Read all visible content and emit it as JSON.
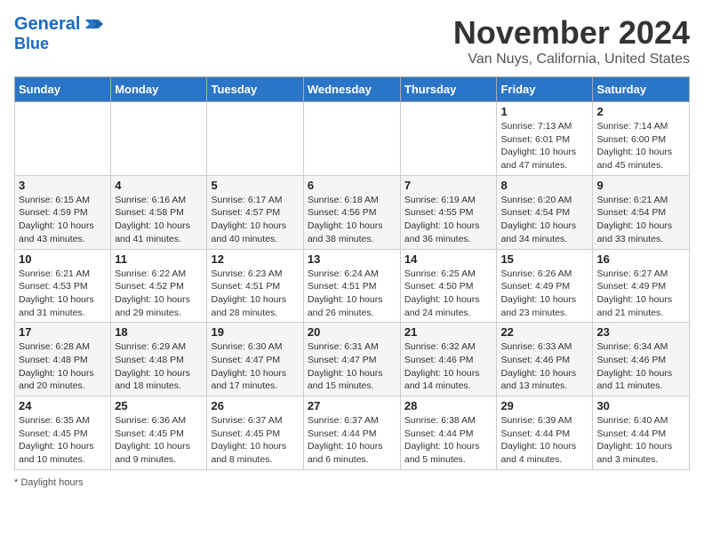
{
  "header": {
    "logo_line1": "General",
    "logo_line2": "Blue",
    "month_title": "November 2024",
    "location": "Van Nuys, California, United States"
  },
  "days_of_week": [
    "Sunday",
    "Monday",
    "Tuesday",
    "Wednesday",
    "Thursday",
    "Friday",
    "Saturday"
  ],
  "weeks": [
    [
      {
        "day": "",
        "info": ""
      },
      {
        "day": "",
        "info": ""
      },
      {
        "day": "",
        "info": ""
      },
      {
        "day": "",
        "info": ""
      },
      {
        "day": "",
        "info": ""
      },
      {
        "day": "1",
        "info": "Sunrise: 7:13 AM\nSunset: 6:01 PM\nDaylight: 10 hours and 47 minutes."
      },
      {
        "day": "2",
        "info": "Sunrise: 7:14 AM\nSunset: 6:00 PM\nDaylight: 10 hours and 45 minutes."
      }
    ],
    [
      {
        "day": "3",
        "info": "Sunrise: 6:15 AM\nSunset: 4:59 PM\nDaylight: 10 hours and 43 minutes."
      },
      {
        "day": "4",
        "info": "Sunrise: 6:16 AM\nSunset: 4:58 PM\nDaylight: 10 hours and 41 minutes."
      },
      {
        "day": "5",
        "info": "Sunrise: 6:17 AM\nSunset: 4:57 PM\nDaylight: 10 hours and 40 minutes."
      },
      {
        "day": "6",
        "info": "Sunrise: 6:18 AM\nSunset: 4:56 PM\nDaylight: 10 hours and 38 minutes."
      },
      {
        "day": "7",
        "info": "Sunrise: 6:19 AM\nSunset: 4:55 PM\nDaylight: 10 hours and 36 minutes."
      },
      {
        "day": "8",
        "info": "Sunrise: 6:20 AM\nSunset: 4:54 PM\nDaylight: 10 hours and 34 minutes."
      },
      {
        "day": "9",
        "info": "Sunrise: 6:21 AM\nSunset: 4:54 PM\nDaylight: 10 hours and 33 minutes."
      }
    ],
    [
      {
        "day": "10",
        "info": "Sunrise: 6:21 AM\nSunset: 4:53 PM\nDaylight: 10 hours and 31 minutes."
      },
      {
        "day": "11",
        "info": "Sunrise: 6:22 AM\nSunset: 4:52 PM\nDaylight: 10 hours and 29 minutes."
      },
      {
        "day": "12",
        "info": "Sunrise: 6:23 AM\nSunset: 4:51 PM\nDaylight: 10 hours and 28 minutes."
      },
      {
        "day": "13",
        "info": "Sunrise: 6:24 AM\nSunset: 4:51 PM\nDaylight: 10 hours and 26 minutes."
      },
      {
        "day": "14",
        "info": "Sunrise: 6:25 AM\nSunset: 4:50 PM\nDaylight: 10 hours and 24 minutes."
      },
      {
        "day": "15",
        "info": "Sunrise: 6:26 AM\nSunset: 4:49 PM\nDaylight: 10 hours and 23 minutes."
      },
      {
        "day": "16",
        "info": "Sunrise: 6:27 AM\nSunset: 4:49 PM\nDaylight: 10 hours and 21 minutes."
      }
    ],
    [
      {
        "day": "17",
        "info": "Sunrise: 6:28 AM\nSunset: 4:48 PM\nDaylight: 10 hours and 20 minutes."
      },
      {
        "day": "18",
        "info": "Sunrise: 6:29 AM\nSunset: 4:48 PM\nDaylight: 10 hours and 18 minutes."
      },
      {
        "day": "19",
        "info": "Sunrise: 6:30 AM\nSunset: 4:47 PM\nDaylight: 10 hours and 17 minutes."
      },
      {
        "day": "20",
        "info": "Sunrise: 6:31 AM\nSunset: 4:47 PM\nDaylight: 10 hours and 15 minutes."
      },
      {
        "day": "21",
        "info": "Sunrise: 6:32 AM\nSunset: 4:46 PM\nDaylight: 10 hours and 14 minutes."
      },
      {
        "day": "22",
        "info": "Sunrise: 6:33 AM\nSunset: 4:46 PM\nDaylight: 10 hours and 13 minutes."
      },
      {
        "day": "23",
        "info": "Sunrise: 6:34 AM\nSunset: 4:46 PM\nDaylight: 10 hours and 11 minutes."
      }
    ],
    [
      {
        "day": "24",
        "info": "Sunrise: 6:35 AM\nSunset: 4:45 PM\nDaylight: 10 hours and 10 minutes."
      },
      {
        "day": "25",
        "info": "Sunrise: 6:36 AM\nSunset: 4:45 PM\nDaylight: 10 hours and 9 minutes."
      },
      {
        "day": "26",
        "info": "Sunrise: 6:37 AM\nSunset: 4:45 PM\nDaylight: 10 hours and 8 minutes."
      },
      {
        "day": "27",
        "info": "Sunrise: 6:37 AM\nSunset: 4:44 PM\nDaylight: 10 hours and 6 minutes."
      },
      {
        "day": "28",
        "info": "Sunrise: 6:38 AM\nSunset: 4:44 PM\nDaylight: 10 hours and 5 minutes."
      },
      {
        "day": "29",
        "info": "Sunrise: 6:39 AM\nSunset: 4:44 PM\nDaylight: 10 hours and 4 minutes."
      },
      {
        "day": "30",
        "info": "Sunrise: 6:40 AM\nSunset: 4:44 PM\nDaylight: 10 hours and 3 minutes."
      }
    ]
  ],
  "footer": {
    "note": "Daylight hours"
  }
}
